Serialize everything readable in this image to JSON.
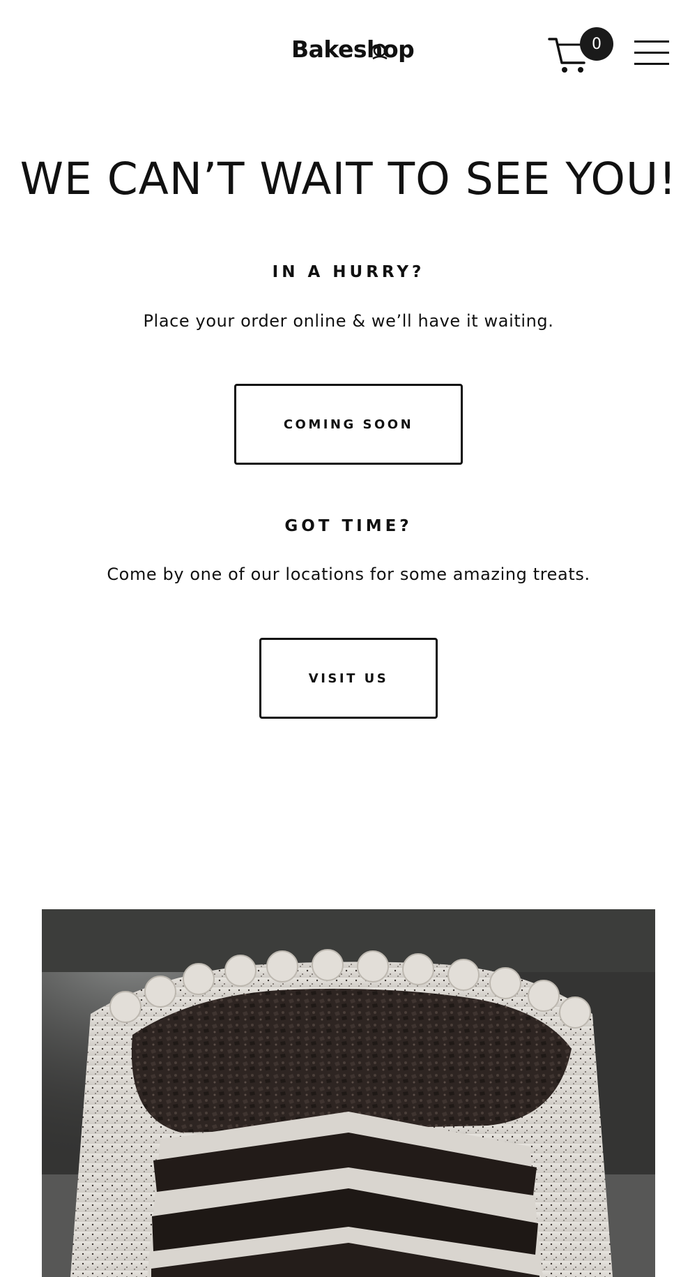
{
  "header": {
    "logo_text": "Bakeshop",
    "cart_count": "0",
    "icons": [
      "cart-icon",
      "hamburger-menu-icon"
    ]
  },
  "hero": {
    "title": "WE CAN’T WAIT TO SEE YOU!"
  },
  "hurry": {
    "heading": "IN A HURRY?",
    "text": "Place your order online & we’ll have it waiting.",
    "button_label": "COMING SOON"
  },
  "got_time": {
    "heading": "GOT TIME?",
    "text": "Come by one of our locations for some amazing treats.",
    "button_label": "VISIT US"
  },
  "image": {
    "subject": "cookies-and-cream-layer-cake"
  },
  "colors": {
    "text": "#111111",
    "background": "#ffffff",
    "badge": "#1a1a1a"
  }
}
